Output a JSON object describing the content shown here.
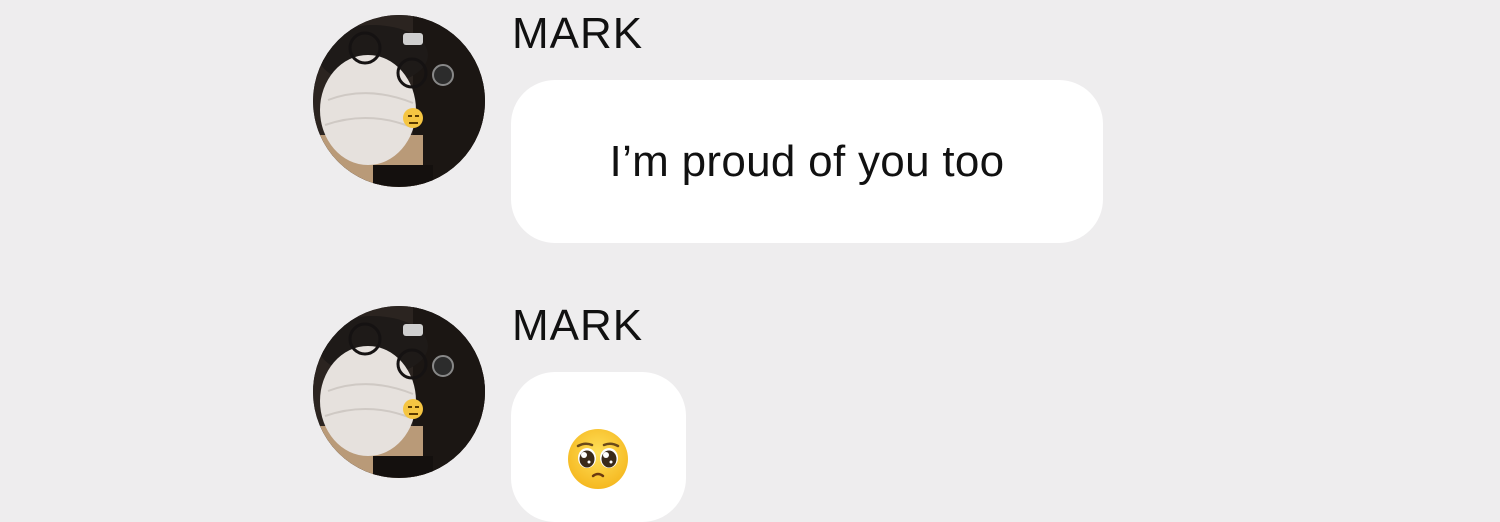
{
  "colors": {
    "background": "#eeedee",
    "bubble": "#ffffff",
    "text": "#111111"
  },
  "messages": [
    {
      "sender": "MARK",
      "text": "I’m proud of you too",
      "avatar_icon": "profile-photo-masked-person"
    },
    {
      "sender": "MARK",
      "text": "",
      "emoji_icon": "pleading-face-emoji",
      "avatar_icon": "profile-photo-masked-person"
    }
  ]
}
